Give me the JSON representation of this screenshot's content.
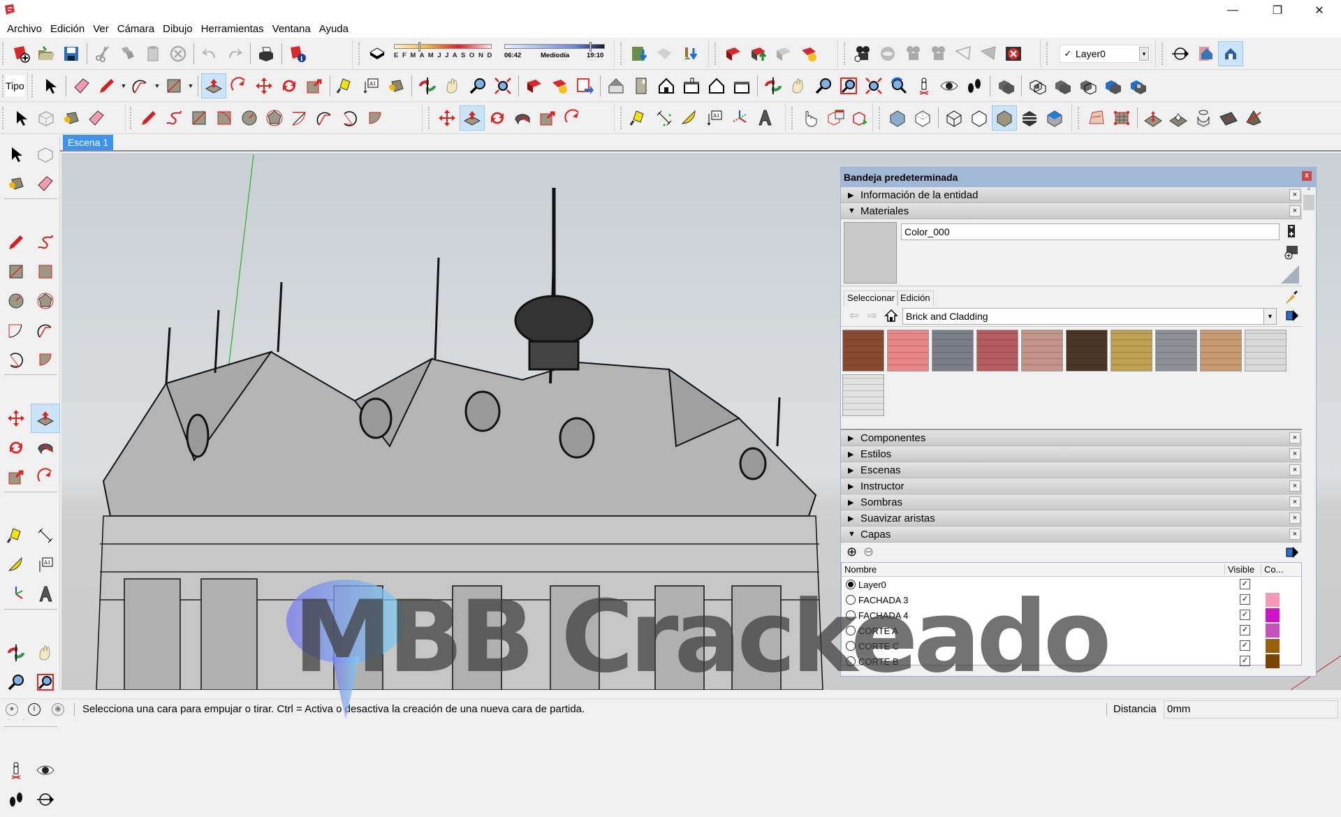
{
  "window": {
    "minimize": "—",
    "maximize": "❐",
    "close": "✕"
  },
  "menu": [
    "Archivo",
    "Edición",
    "Ver",
    "Cámara",
    "Dibujo",
    "Herramientas",
    "Ventana",
    "Ayuda"
  ],
  "toolbar": {
    "tipo_label": "Tipo",
    "shadow": {
      "months": "E F M A M J J A S O N D",
      "time_start": "06:42",
      "time_mid": "Mediodía",
      "time_end": "19:10",
      "month_value": 0.25,
      "time_value": 0.85
    },
    "layer_select": {
      "check": "✓",
      "value": "Layer0"
    }
  },
  "scene": {
    "tab": "Escena 1"
  },
  "tray": {
    "title": "Bandeja predeterminada",
    "close": "x",
    "panels_top": [
      {
        "label": "Información de la entidad",
        "expanded": false
      },
      {
        "label": "Materiales",
        "expanded": true
      }
    ],
    "materials": {
      "name": "Color_000",
      "tab_select": "Seleccionar",
      "tab_edit": "Edición",
      "collection": "Brick and Cladding",
      "swatches": [
        {
          "name": "brick-red",
          "color": "#8a4a32"
        },
        {
          "name": "pink-pavers",
          "color": "#e8868a"
        },
        {
          "name": "granite-blocks",
          "color": "#7a7f88"
        },
        {
          "name": "red-tile",
          "color": "#b65c60"
        },
        {
          "name": "stone-pavers",
          "color": "#c3948a"
        },
        {
          "name": "dark-brick",
          "color": "#4a3526"
        },
        {
          "name": "yellow-brick",
          "color": "#bfa050"
        },
        {
          "name": "grey-stone",
          "color": "#8d9096"
        },
        {
          "name": "wood-siding",
          "color": "#c79a72"
        },
        {
          "name": "white-siding",
          "color": "#d9d9d9"
        },
        {
          "name": "stucco",
          "color": "#e2e2e2"
        }
      ]
    },
    "panels_bottom": [
      {
        "label": "Componentes",
        "expanded": false
      },
      {
        "label": "Estilos",
        "expanded": false
      },
      {
        "label": "Escenas",
        "expanded": false
      },
      {
        "label": "Instructor",
        "expanded": false
      },
      {
        "label": "Sombras",
        "expanded": false
      },
      {
        "label": "Suavizar aristas",
        "expanded": false
      },
      {
        "label": "Capas",
        "expanded": true
      }
    ],
    "layers": {
      "col_name": "Nombre",
      "col_visible": "Visible",
      "col_color": "Co...",
      "rows": [
        {
          "name": "Layer0",
          "active": true,
          "visible": true,
          "color": ""
        },
        {
          "name": "FACHADA 3",
          "active": false,
          "visible": true,
          "color": "#f49ab8"
        },
        {
          "name": "FACHADA 4",
          "active": false,
          "visible": true,
          "color": "#d011c8"
        },
        {
          "name": "CORTE A",
          "active": false,
          "visible": true,
          "color": "#c750c0"
        },
        {
          "name": "CORTE C",
          "active": false,
          "visible": true,
          "color": "#9a5e0c"
        },
        {
          "name": "CORTE B",
          "active": false,
          "visible": true,
          "color": "#7a4400"
        }
      ],
      "check": "✓"
    }
  },
  "status": {
    "message": "Selecciona una cara para empujar o tirar. Ctrl = Activa o desactiva la creación de una nueva cara de partida.",
    "measure_label": "Distancia",
    "measure_value": "0mm"
  },
  "watermark": "MBB Crackeado"
}
